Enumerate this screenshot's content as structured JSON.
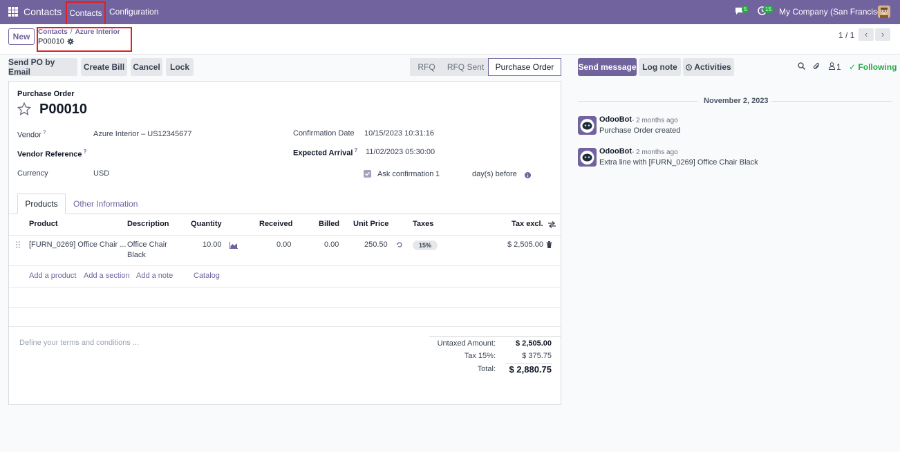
{
  "topbar": {
    "app_name": "Contacts",
    "menu": [
      "Contacts",
      "Configuration"
    ],
    "messages_count": "5",
    "activities_count": "15",
    "company": "My Company (San Francisco)"
  },
  "control": {
    "new_label": "New",
    "breadcrumb": [
      "Contacts",
      "Azure Interior"
    ],
    "record": "P00010",
    "pager": "1 / 1"
  },
  "actions": [
    "Send PO by Email",
    "Create Bill",
    "Cancel",
    "Lock"
  ],
  "statusbar": [
    "RFQ",
    "RFQ Sent",
    "Purchase Order"
  ],
  "form": {
    "doc_type": "Purchase Order",
    "name": "P00010",
    "vendor_label": "Vendor",
    "vendor_value": "Azure Interior – US12345677",
    "vendor_ref_label": "Vendor Reference",
    "currency_label": "Currency",
    "currency_value": "USD",
    "confirmation_label": "Confirmation Date",
    "confirmation_value": "10/15/2023 10:31:16",
    "expected_label": "Expected Arrival",
    "expected_value": "11/02/2023 05:30:00",
    "ask_label": "Ask confirmation",
    "ask_days": "1",
    "ask_suffix": "day(s) before"
  },
  "tabs": [
    "Products",
    "Other Information"
  ],
  "table": {
    "headers": [
      "Product",
      "Description",
      "Quantity",
      "Received",
      "Billed",
      "Unit Price",
      "Taxes",
      "Tax excl."
    ],
    "row": {
      "product": "[FURN_0269] Office Chair ...",
      "description_1": "Office Chair",
      "description_2": "Black",
      "quantity": "10.00",
      "received": "0.00",
      "billed": "0.00",
      "unit_price": "250.50",
      "tax": "15%",
      "subtotal": "$ 2,505.00"
    },
    "add_links": [
      "Add a product",
      "Add a section",
      "Add a note",
      "Catalog"
    ]
  },
  "terms_placeholder": "Define your terms and conditions ...",
  "totals": {
    "untaxed_label": "Untaxed Amount:",
    "untaxed_value": "$ 2,505.00",
    "tax_label": "Tax 15%:",
    "tax_value": "$ 375.75",
    "total_label": "Total:",
    "total_value": "$ 2,880.75"
  },
  "chatter": {
    "send_message": "Send message",
    "log_note": "Log note",
    "activities": "Activities",
    "followers_count": "1",
    "following": "Following",
    "date": "November 2, 2023",
    "messages": [
      {
        "author": "OdooBot",
        "time": "- 2 months ago",
        "body": "Purchase Order created"
      },
      {
        "author": "OdooBot",
        "time": "- 2 months ago",
        "body": "Extra line with [FURN_0269] Office Chair Black"
      }
    ]
  }
}
